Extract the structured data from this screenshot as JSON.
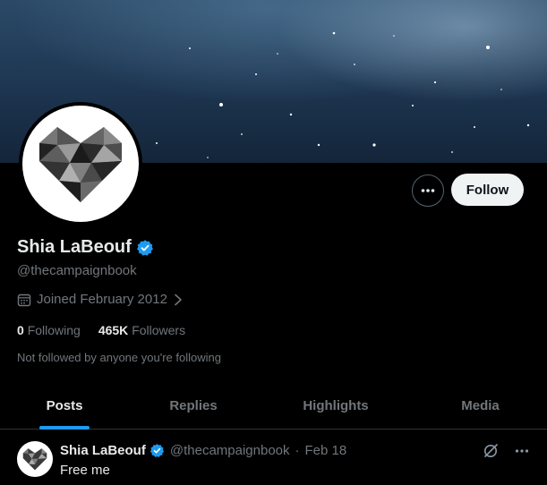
{
  "profile": {
    "display_name": "Shia LaBeouf",
    "handle": "@thecampaignbook",
    "joined": "Joined February 2012",
    "following_count": "0",
    "following_label": "Following",
    "followers_count": "465K",
    "followers_label": "Followers",
    "not_followed_text": "Not followed by anyone you're following",
    "verified_icon": "verified-badge-icon",
    "avatar_icon": "pixel-heart-icon"
  },
  "actions": {
    "more_icon": "more-dots-icon",
    "follow_label": "Follow"
  },
  "tabs": [
    {
      "label": "Posts",
      "active": true
    },
    {
      "label": "Replies",
      "active": false
    },
    {
      "label": "Highlights",
      "active": false
    },
    {
      "label": "Media",
      "active": false
    }
  ],
  "post": {
    "name": "Shia LaBeouf",
    "handle": "@thecampaignbook",
    "separator": "·",
    "date": "Feb 18",
    "text": "Free me"
  },
  "colors": {
    "accent": "#1d9bf0",
    "background": "#000000",
    "text_primary": "#e7e9ea",
    "text_secondary": "#71767b"
  }
}
